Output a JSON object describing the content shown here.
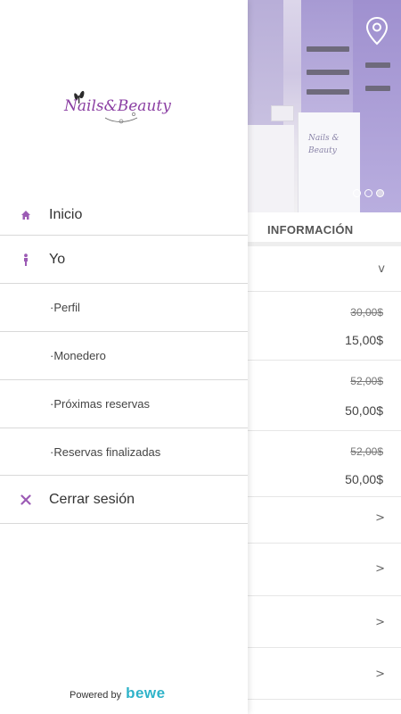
{
  "drawer": {
    "logo_text": "Nails&Beauty",
    "items": [
      {
        "label": "Inicio",
        "icon": "home-icon"
      },
      {
        "label": "Yo",
        "icon": "person-icon"
      },
      {
        "label": "·Perfil"
      },
      {
        "label": "·Monedero"
      },
      {
        "label": "·Próximas reservas"
      },
      {
        "label": "·Reservas finalizadas"
      },
      {
        "label": "Cerrar sesión",
        "icon": "close-icon"
      }
    ],
    "powered_label": "Powered by",
    "powered_brand": "bewe"
  },
  "background": {
    "hero_sign": "Nails & Beauty",
    "section_title": "INFORMACIÓN",
    "rows": [
      {
        "chevron": "v"
      },
      {
        "old_price": "30,00$",
        "price": "15,00$"
      },
      {
        "old_price": "52,00$",
        "price": "50,00$"
      },
      {
        "old_price": "52,00$",
        "price": "50,00$"
      },
      {
        "chevron": ">"
      },
      {
        "chevron": ">"
      },
      {
        "chevron": ">"
      },
      {
        "chevron": ">"
      }
    ]
  },
  "colors": {
    "accent": "#9c5bb5",
    "brand": "#2fb3c9",
    "divider": "#d9d9d9"
  }
}
